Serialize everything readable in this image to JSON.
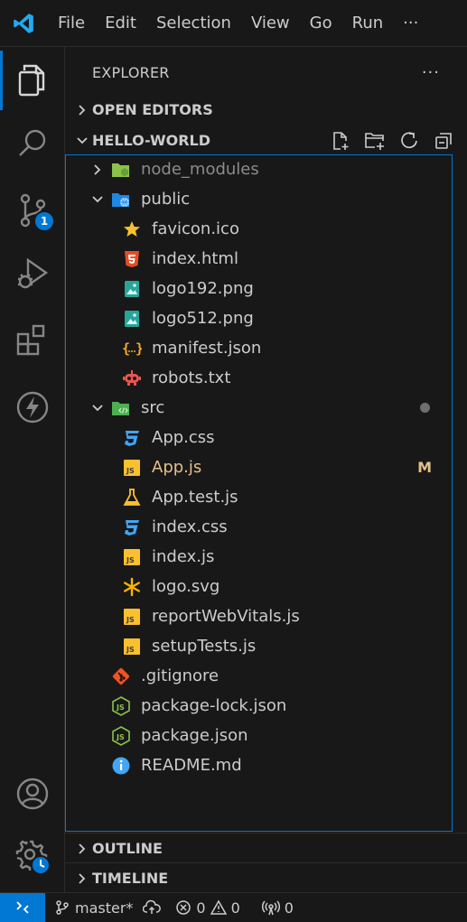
{
  "titlebar": {
    "menu": [
      "File",
      "Edit",
      "Selection",
      "View",
      "Go",
      "Run",
      "···"
    ]
  },
  "activity_bar": {
    "items": [
      "explorer-icon",
      "search-icon",
      "source-control-icon",
      "run-debug-icon",
      "extensions-icon",
      "thunder-client-icon"
    ],
    "bottom": [
      "account-icon",
      "settings-gear-icon"
    ],
    "source_control_badge": "1"
  },
  "sidebar": {
    "title": "EXPLORER",
    "more": "···",
    "open_editors": "OPEN EDITORS",
    "workspace": "HELLO-WORLD",
    "outline": "OUTLINE",
    "timeline": "TIMELINE"
  },
  "tree": [
    {
      "label": "node_modules",
      "icon": "folder-node-icon",
      "kind": "folder",
      "expanded": false,
      "depth": 0,
      "dim": true
    },
    {
      "label": "public",
      "icon": "folder-public-icon",
      "kind": "folder",
      "expanded": true,
      "depth": 0
    },
    {
      "label": "favicon.ico",
      "icon": "star-icon",
      "kind": "file",
      "depth": 1
    },
    {
      "label": "index.html",
      "icon": "html5-icon",
      "kind": "file",
      "depth": 1
    },
    {
      "label": "logo192.png",
      "icon": "image-icon",
      "kind": "file",
      "depth": 1
    },
    {
      "label": "logo512.png",
      "icon": "image-icon",
      "kind": "file",
      "depth": 1
    },
    {
      "label": "manifest.json",
      "icon": "json-icon",
      "kind": "file",
      "depth": 1
    },
    {
      "label": "robots.txt",
      "icon": "robot-icon",
      "kind": "file",
      "depth": 1
    },
    {
      "label": "src",
      "icon": "folder-src-icon",
      "kind": "folder",
      "expanded": true,
      "depth": 0,
      "dot": true
    },
    {
      "label": "App.css",
      "icon": "css-icon",
      "kind": "file",
      "depth": 1
    },
    {
      "label": "App.js",
      "icon": "js-icon",
      "kind": "file",
      "depth": 1,
      "status": "M"
    },
    {
      "label": "App.test.js",
      "icon": "test-flask-icon",
      "kind": "file",
      "depth": 1
    },
    {
      "label": "index.css",
      "icon": "css-icon",
      "kind": "file",
      "depth": 1
    },
    {
      "label": "index.js",
      "icon": "js-icon",
      "kind": "file",
      "depth": 1
    },
    {
      "label": "logo.svg",
      "icon": "svg-asterisk-icon",
      "kind": "file",
      "depth": 1
    },
    {
      "label": "reportWebVitals.js",
      "icon": "js-icon",
      "kind": "file",
      "depth": 1
    },
    {
      "label": "setupTests.js",
      "icon": "js-icon",
      "kind": "file",
      "depth": 1
    },
    {
      "label": ".gitignore",
      "icon": "git-icon",
      "kind": "file",
      "depth": 0
    },
    {
      "label": "package-lock.json",
      "icon": "nodejs-icon",
      "kind": "file",
      "depth": 0
    },
    {
      "label": "package.json",
      "icon": "nodejs-icon",
      "kind": "file",
      "depth": 0
    },
    {
      "label": "README.md",
      "icon": "info-icon",
      "kind": "file",
      "depth": 0
    }
  ],
  "statusbar": {
    "branch": "master*",
    "errors": "0",
    "warnings": "0",
    "ports": "0"
  },
  "colors": {
    "accent": "#0078d4",
    "modified": "#e2c08d",
    "background": "#181818"
  }
}
